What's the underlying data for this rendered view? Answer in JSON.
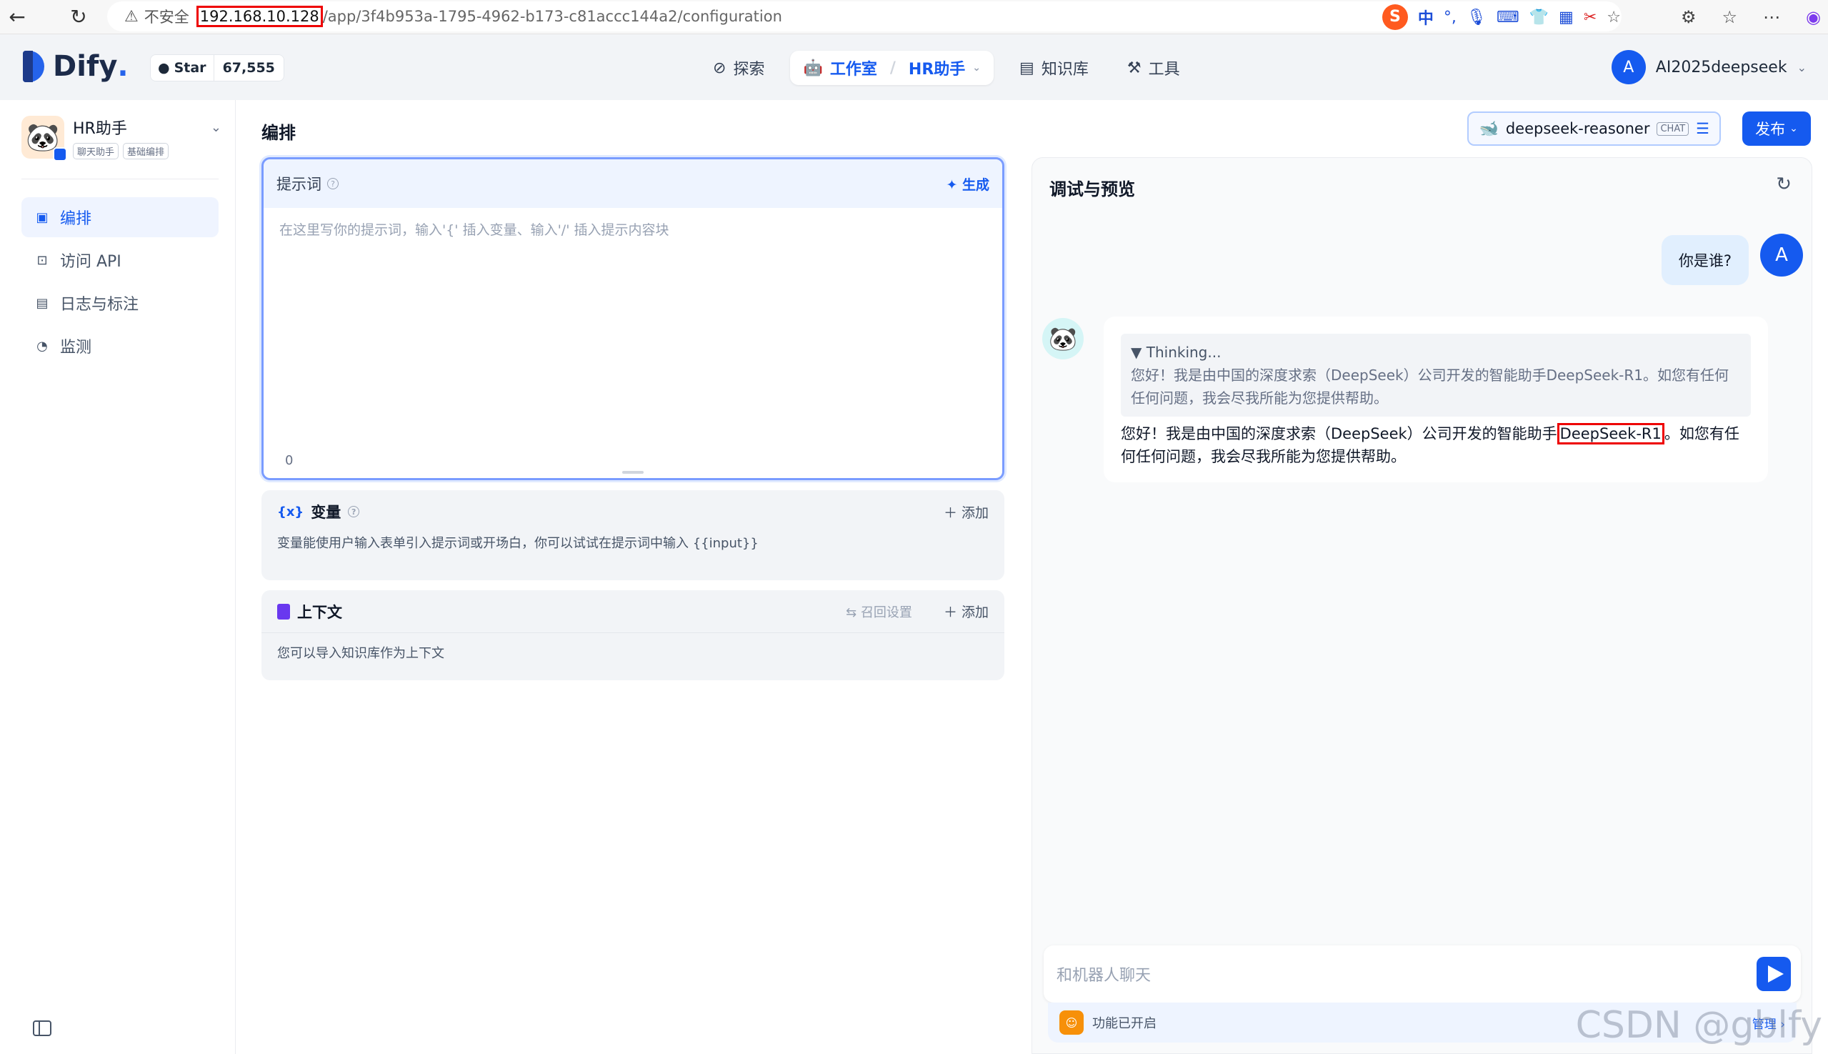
{
  "browser": {
    "security_label": "不安全",
    "url_host": "192.168.10.128",
    "url_path": "/app/3f4b953a-1795-4962-b173-c81accc144a2/configuration",
    "ext_ime_label": "中"
  },
  "header": {
    "logo_text": "Dify",
    "logo_suffix": ".",
    "star_label": "Star",
    "star_count": "67,555",
    "nav": {
      "explore": "探索",
      "studio": "工作室",
      "app": "HR助手",
      "knowledge": "知识库",
      "tools": "工具"
    },
    "user_initial": "A",
    "user_name": "AI2025deepseek"
  },
  "sidebar": {
    "app_name": "HR助手",
    "tags": [
      "聊天助手",
      "基础编排"
    ],
    "items": [
      {
        "label": "编排",
        "icon": "layout-icon"
      },
      {
        "label": "访问 API",
        "icon": "terminal-icon"
      },
      {
        "label": "日志与标注",
        "icon": "file-list-icon"
      },
      {
        "label": "监测",
        "icon": "gauge-icon"
      }
    ]
  },
  "main": {
    "title": "编排",
    "model": {
      "name": "deepseek-reasoner",
      "tag": "CHAT"
    },
    "publish_label": "发布",
    "prompt": {
      "label": "提示词",
      "generate_label": "生成",
      "placeholder": "在这里写你的提示词，输入'{' 插入变量、输入'/' 插入提示内容块",
      "count": "0"
    },
    "variables": {
      "label": "变量",
      "add_label": "添加",
      "desc": "变量能使用户输入表单引入提示词或开场白，你可以试试在提示词中输入 {{input}}"
    },
    "context": {
      "label": "上下文",
      "recall_label": "召回设置",
      "add_label": "添加",
      "desc": "您可以导入知识库作为上下文"
    }
  },
  "debug": {
    "title": "调试与预览",
    "user_message": "你是谁?",
    "user_initial": "A",
    "thinking_title": "▼ Thinking...",
    "thinking_text": "您好！我是由中国的深度求索（DeepSeek）公司开发的智能助手DeepSeek-R1。如您有任何任何问题，我会尽我所能为您提供帮助。",
    "answer_pre": "您好！我是由中国的深度求索（DeepSeek）公司开发的智能助手",
    "answer_highlight": "DeepSeek-R1",
    "answer_post": "。如您有任何任何问题，我会尽我所能为您提供帮助。",
    "input_placeholder": "和机器人聊天",
    "feature_label": "功能已开启",
    "manage_label": "管理"
  },
  "watermark": "CSDN @gblfy"
}
